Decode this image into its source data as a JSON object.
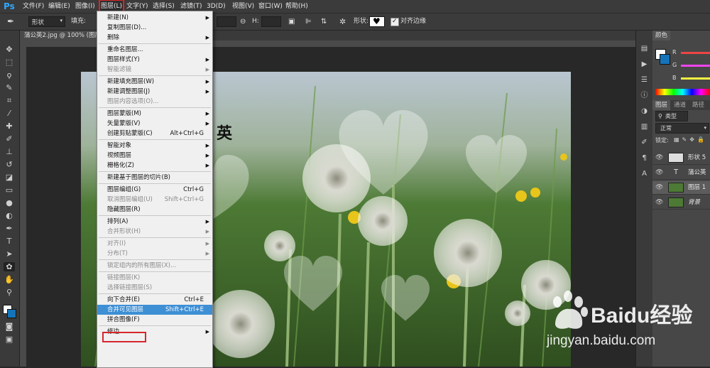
{
  "app": {
    "logo": "Ps"
  },
  "menubar": {
    "items": [
      "文件(F)",
      "编辑(E)",
      "图像(I)",
      "图层(L)",
      "文字(Y)",
      "选择(S)",
      "滤镜(T)",
      "3D(D)",
      "视图(V)",
      "窗口(W)",
      "帮助(H)"
    ],
    "active": "图层(L)"
  },
  "options_bar": {
    "shape_mode": "形状",
    "fill_label": "填充:",
    "h_label": "H:",
    "shape_label": "形状:",
    "align_edges_label": "对齐边缘",
    "align_edges_checked": true
  },
  "document": {
    "tab_title": "蒲公英2.jpg @ 100% (图层",
    "canvas_text": "英"
  },
  "layer_menu": {
    "items": [
      {
        "label": "新建(N)",
        "submenu": true
      },
      {
        "label": "复制图层(D)..."
      },
      {
        "label": "删除",
        "submenu": true
      },
      {
        "sep": true
      },
      {
        "label": "重命名图层..."
      },
      {
        "label": "图层样式(Y)",
        "submenu": true
      },
      {
        "label": "智能滤镜",
        "disabled": true,
        "submenu": true
      },
      {
        "sep": true
      },
      {
        "label": "新建填充图层(W)",
        "submenu": true
      },
      {
        "label": "新建调整图层(J)",
        "submenu": true
      },
      {
        "label": "图层内容选项(O)...",
        "disabled": true
      },
      {
        "sep": true
      },
      {
        "label": "图层蒙版(M)",
        "submenu": true
      },
      {
        "label": "矢量蒙版(V)",
        "submenu": true
      },
      {
        "label": "创建剪贴蒙版(C)",
        "shortcut": "Alt+Ctrl+G"
      },
      {
        "sep": true
      },
      {
        "label": "智能对象",
        "submenu": true
      },
      {
        "label": "视频图层",
        "submenu": true
      },
      {
        "label": "栅格化(Z)",
        "submenu": true
      },
      {
        "sep": true
      },
      {
        "label": "新建基于图层的切片(B)"
      },
      {
        "sep": true
      },
      {
        "label": "图层编组(G)",
        "shortcut": "Ctrl+G"
      },
      {
        "label": "取消图层编组(U)",
        "shortcut": "Shift+Ctrl+G",
        "disabled": true
      },
      {
        "label": "隐藏图层(R)"
      },
      {
        "sep": true
      },
      {
        "label": "排列(A)",
        "submenu": true
      },
      {
        "label": "合并形状(H)",
        "disabled": true,
        "submenu": true
      },
      {
        "sep": true
      },
      {
        "label": "对齐(I)",
        "disabled": true,
        "submenu": true
      },
      {
        "label": "分布(T)",
        "disabled": true,
        "submenu": true
      },
      {
        "sep": true
      },
      {
        "label": "锁定组内的所有图层(X)...",
        "disabled": true
      },
      {
        "sep": true
      },
      {
        "label": "链接图层(K)",
        "disabled": true
      },
      {
        "label": "选择链接图层(S)",
        "disabled": true
      },
      {
        "sep": true
      },
      {
        "label": "向下合并(E)",
        "shortcut": "Ctrl+E"
      },
      {
        "label": "合并可见图层",
        "shortcut": "Shift+Ctrl+E",
        "highlighted": true
      },
      {
        "label": "拼合图像(F)"
      },
      {
        "sep": true
      },
      {
        "label": "修边",
        "submenu": true
      }
    ]
  },
  "color_panel": {
    "title": "颜色",
    "sliders": [
      "R",
      "G",
      "B"
    ]
  },
  "layers_panel": {
    "tabs": [
      "图层",
      "通道",
      "路径"
    ],
    "filter_label": "类型",
    "blend_mode": "正常",
    "lock_label": "锁定:",
    "layers": [
      {
        "name": "形状 5",
        "kind": "shape"
      },
      {
        "name": "蒲公英",
        "kind": "text"
      },
      {
        "name": "图层 1",
        "kind": "image",
        "selected": true
      },
      {
        "name": "背景",
        "kind": "image",
        "italic": true
      }
    ]
  },
  "watermark": {
    "brand": "Baidu经验",
    "url": "jingyan.baidu.com"
  },
  "colors": {
    "accent": "#31a8ff",
    "highlight": "#3e8fd4",
    "annotation": "#d8262c"
  }
}
